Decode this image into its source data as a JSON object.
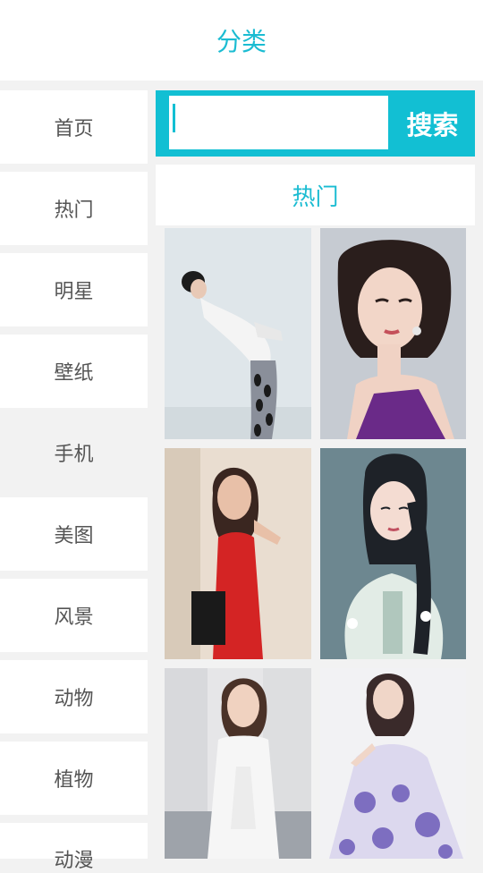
{
  "header": {
    "title": "分类"
  },
  "sidebar": {
    "items": [
      {
        "label": "首页"
      },
      {
        "label": "热门"
      },
      {
        "label": "明星"
      },
      {
        "label": "壁纸"
      },
      {
        "label": "手机",
        "active": true
      },
      {
        "label": "美图"
      },
      {
        "label": "风景"
      },
      {
        "label": "动物"
      },
      {
        "label": "植物"
      },
      {
        "label": "动漫"
      }
    ]
  },
  "search": {
    "value": "",
    "button_label": "搜索"
  },
  "hot_tab": {
    "label": "热门"
  },
  "photos": [
    {
      "name": "photo-woman-white-blouse"
    },
    {
      "name": "photo-woman-purple-dress"
    },
    {
      "name": "photo-woman-red-dress"
    },
    {
      "name": "photo-anime-girl"
    },
    {
      "name": "photo-woman-white-gown"
    },
    {
      "name": "photo-woman-floral-gown"
    }
  ],
  "colors": {
    "accent": "#1bbcd2",
    "search_bg": "#12bfd3",
    "page_bg": "#f2f2f2"
  }
}
